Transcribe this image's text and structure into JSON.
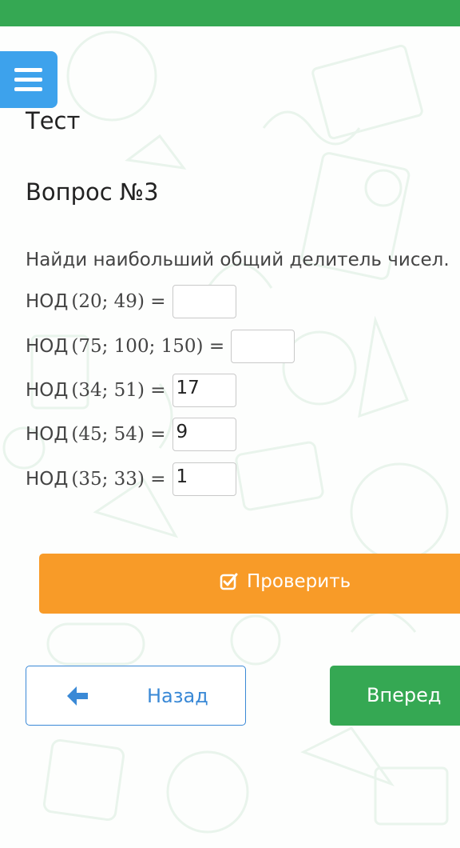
{
  "header": {
    "accent_color": "#35a853"
  },
  "menu": {
    "icon": "hamburger-icon",
    "color": "#3da2ec"
  },
  "test_title": "Тест",
  "question_title": "Вопрос №3",
  "instruction": "Найди наибольший общий делитель чисел.",
  "equations": [
    {
      "label": "НОД",
      "expr": "(20; 49) =",
      "value": ""
    },
    {
      "label": "НОД",
      "expr": "(75; 100; 150) =",
      "value": ""
    },
    {
      "label": "НОД",
      "expr": "(34; 51) =",
      "value": "17"
    },
    {
      "label": "НОД",
      "expr": "(45; 54) =",
      "value": "9"
    },
    {
      "label": "НОД",
      "expr": "(35; 33) =",
      "value": "1"
    }
  ],
  "check_button": {
    "label": "Проверить",
    "icon": "checkbox-icon",
    "color": "#f89b28"
  },
  "back_button": {
    "label": "Назад",
    "icon": "arrow-left-icon",
    "color": "#3a89d6"
  },
  "forward_button": {
    "label": "Вперед",
    "color": "#35a853"
  }
}
